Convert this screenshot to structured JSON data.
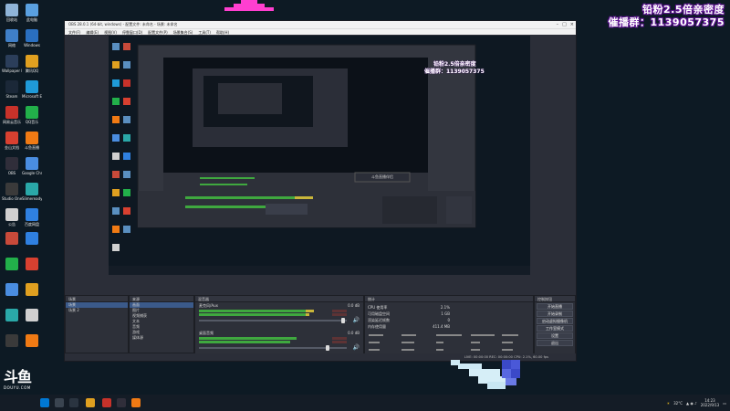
{
  "overlay": {
    "line1": "铅粉2.5倍亲密度",
    "line2": "催播群：1139057375"
  },
  "desktop_icons": [
    {
      "label": "回收站",
      "color": "#8fb4d8"
    },
    {
      "label": "此电脑",
      "color": "#5aa0e0"
    },
    {
      "label": "网络",
      "color": "#3f7fc8"
    },
    {
      "label": "Windows",
      "color": "#2a6fc0"
    },
    {
      "label": "Wallpaper Engine",
      "color": "#2b3e5a"
    },
    {
      "label": "腾讯QQ",
      "color": "#e0a020"
    },
    {
      "label": "Steam",
      "color": "#1b2838"
    },
    {
      "label": "Microsoft Edge",
      "color": "#1f9ad8"
    },
    {
      "label": "网易云音乐",
      "color": "#c8322a"
    },
    {
      "label": "QQ音乐",
      "color": "#22b04a"
    },
    {
      "label": "金山文档",
      "color": "#d84030"
    },
    {
      "label": "斗鱼直播",
      "color": "#f07a14"
    },
    {
      "label": "OBS",
      "color": "#302e3a"
    },
    {
      "label": "Google Chrome",
      "color": "#4a8de0"
    },
    {
      "label": "Studio One",
      "color": "#3a3a3a"
    },
    {
      "label": "Slimeready",
      "color": "#2aa8a8"
    },
    {
      "label": "公告",
      "color": "#d0d0d0"
    },
    {
      "label": "百度网盘",
      "color": "#2f80e0"
    }
  ],
  "obs": {
    "title": "OBS 28.0.1 (64-bit, windows) - 配置文件: 未命名 - 场景: 未命名",
    "menu": [
      "文件(F)",
      "编辑(E)",
      "视图(V)",
      "停靠窗口(D)",
      "配置文件(P)",
      "场景集合(S)",
      "工具(T)",
      "帮助(H)"
    ],
    "scenes_title": "场景",
    "scenes": [
      "场景",
      "场景 2"
    ],
    "sources_title": "来源",
    "sources": [
      "画面",
      "图片",
      "视频捕获",
      "文本",
      "音频",
      "游戏",
      "媒体源"
    ],
    "mixer_title": "混音器",
    "mixer_channels": [
      {
        "name": "麦克风/Aux",
        "db": "0.0 dB",
        "level": 0.78
      },
      {
        "name": "桌面音频",
        "db": "0.0 dB",
        "level": 0.66
      }
    ],
    "stats_title": "统计",
    "stats": [
      [
        "CPU 使用率",
        "2.1%"
      ],
      [
        "可用磁盘空间",
        "1 GB"
      ],
      [
        "渲染延迟帧数",
        "0"
      ],
      [
        "内存使用量",
        "411.4 MB"
      ]
    ],
    "controls_title": "控制按钮",
    "controls": [
      "开始直播",
      "开始录制",
      "启动虚拟摄像机",
      "工作室模式",
      "设置",
      "退出"
    ],
    "status": "LIVE: 00:00:00   REC: 00:00:00   CPU: 2.1%, 60.00 fps"
  },
  "preview_caption": "斗鱼直播伴侣",
  "douyu": {
    "mark": "斗鱼",
    "site": "DOUYU.COM"
  },
  "taskbar": {
    "temp": "32°C",
    "time": "14:23",
    "date": "2022/9/13"
  }
}
